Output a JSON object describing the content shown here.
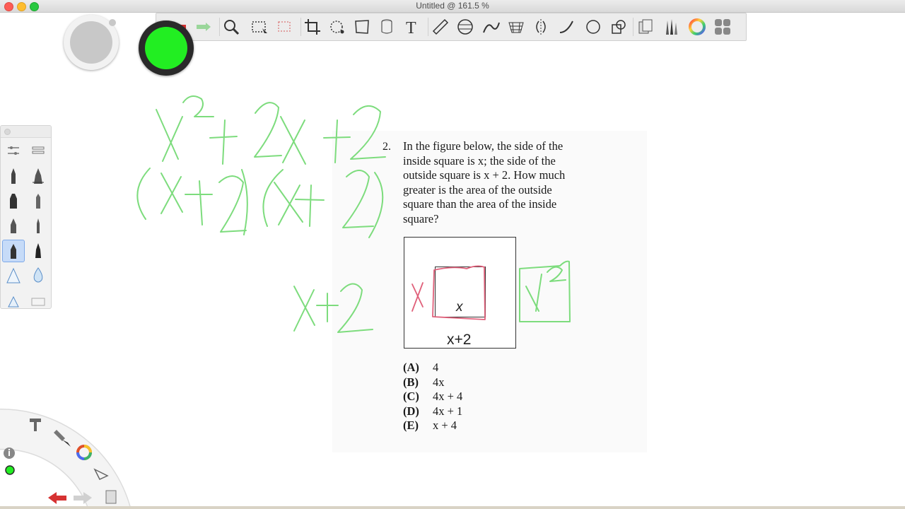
{
  "window": {
    "title": "Untitled @ 161.5 %"
  },
  "toolbar": {
    "tools": [
      "undo-icon",
      "redo-icon",
      "zoom-icon",
      "rect-select-icon",
      "free-select-icon",
      "crop-icon",
      "transform-icon",
      "distort-icon",
      "cylinder-icon",
      "text-icon",
      "ruler-icon",
      "ellipse-guide-icon",
      "french-curve-icon",
      "perspective-icon",
      "symmetry-icon",
      "stroke-icon",
      "circle-icon",
      "shapes-icon",
      "layers-icon",
      "brush-library-icon",
      "color-wheel-icon",
      "grid-menu-icon"
    ]
  },
  "colors": {
    "current": "#22ee22",
    "ink_green": "#7ddc7d",
    "ink_red": "#e0607a"
  },
  "problem": {
    "number": "2.",
    "lines": [
      "In the figure below, the side of the",
      "inside square is x; the side of the",
      "outside square is x + 2. How much",
      "greater is the area of the outside",
      "square than the area of the inside",
      "square?"
    ],
    "figure": {
      "inner_label": "x",
      "outer_label": "x+2"
    },
    "answers": [
      {
        "letter": "(A)",
        "value": "4"
      },
      {
        "letter": "(B)",
        "value": "4x"
      },
      {
        "letter": "(C)",
        "value": "4x + 4"
      },
      {
        "letter": "(D)",
        "value": "4x + 1"
      },
      {
        "letter": "(E)",
        "value": "x + 4"
      }
    ]
  }
}
